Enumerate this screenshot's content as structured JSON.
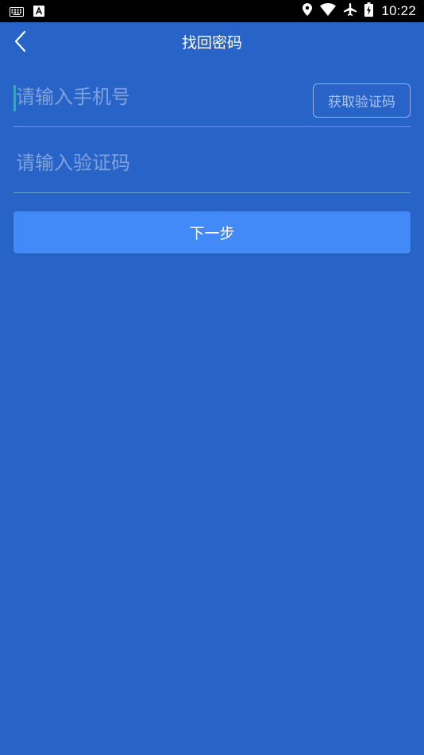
{
  "status_bar": {
    "time": "10:22",
    "icons": [
      "keyboard-icon",
      "a-notification-icon",
      "location-icon",
      "wifi-icon",
      "airplane-icon",
      "battery-charging-icon"
    ]
  },
  "header": {
    "title": "找回密码",
    "back_icon": "chevron-left-icon"
  },
  "form": {
    "phone_placeholder": "请输入手机号",
    "phone_value": "",
    "get_code_label": "获取验证码",
    "code_placeholder": "请输入验证码",
    "code_value": ""
  },
  "next_button_label": "下一步",
  "colors": {
    "background": "#2864c8",
    "primary_button": "#428af8",
    "placeholder": "#7fa1dc",
    "cursor": "#1fb89a"
  }
}
